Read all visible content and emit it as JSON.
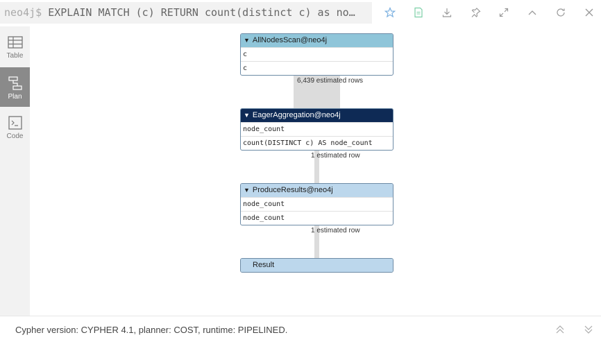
{
  "header": {
    "prompt": "neo4j$",
    "query": " EXPLAIN MATCH (c) RETURN count(distinct c) as no…"
  },
  "icons": {
    "favorite": "star-icon",
    "save": "save-file-icon",
    "download": "download-icon",
    "pin": "pin-icon",
    "fullscreen": "expand-icon",
    "collapse": "chevron-up-icon",
    "rerun": "refresh-icon",
    "close": "close-icon"
  },
  "sidebar": {
    "items": [
      {
        "label": "Table",
        "icon": "table-icon"
      },
      {
        "label": "Plan",
        "icon": "plan-icon",
        "active": true
      },
      {
        "label": "Code",
        "icon": "code-icon"
      }
    ]
  },
  "plan": {
    "operators": [
      {
        "title": "AllNodesScan@neo4j",
        "color": "#8fc5d9",
        "rows": [
          "c",
          "c"
        ]
      },
      {
        "title": "EagerAggregation@neo4j",
        "color": "#0e2a55",
        "rows": [
          "node_count",
          "count(DISTINCT c) AS node_count"
        ]
      },
      {
        "title": "ProduceResults@neo4j",
        "color": "#bcd7ec",
        "rows": [
          "node_count",
          "node_count"
        ]
      },
      {
        "title": "Result",
        "color": "#bcd7ec",
        "rows": []
      }
    ],
    "estimates": [
      "6,439 estimated rows",
      "1 estimated row",
      "1 estimated row"
    ],
    "triangle": "▼"
  },
  "footer": {
    "text": "Cypher version: CYPHER 4.1, planner: COST, runtime: PIPELINED."
  }
}
